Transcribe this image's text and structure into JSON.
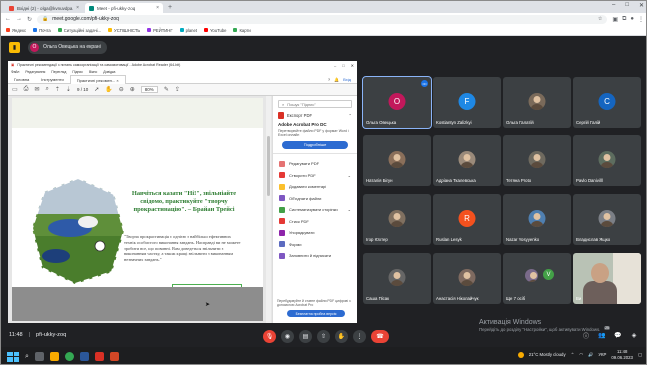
{
  "browser": {
    "tabs": [
      {
        "title": "Вхідні (2) - olga@kvnuvdpa.ua",
        "fav": "#ea4335",
        "active": false
      },
      {
        "title": "Meet - pfi-ukky-zoq",
        "fav": "#00897b",
        "active": true
      }
    ],
    "new_tab": "+",
    "url": "meet.google.com/pfi-ukky-zoq",
    "bookmarks": [
      {
        "label": "Яндекс",
        "color": "#fc3f1d"
      },
      {
        "label": "Почта",
        "color": "#1a73e8"
      },
      {
        "label": "Ситуаційні задачі...",
        "color": "#34a853"
      },
      {
        "label": "УСПІШНІСТЬ",
        "color": "#fbbc04"
      },
      {
        "label": "РЕЙТИНГ",
        "color": "#9334e6"
      },
      {
        "label": "planet",
        "color": "#00acc1"
      },
      {
        "label": "YouTube",
        "color": "#ff0000"
      },
      {
        "label": "Карти",
        "color": "#34a853"
      }
    ]
  },
  "meet": {
    "presenter_initial": "О",
    "presenter_label": "Ольга Овецька на екрані",
    "meeting_time": "11:48",
    "meeting_code": "pfi-ukky-zoq",
    "participant_count": "25"
  },
  "acrobat": {
    "title": "Практичні рекомендації з питань самоорганізації та самомотивації - Adobe Acrobat Reader (64-bit)",
    "menu": [
      "Файл",
      "Редагування",
      "Перегляд",
      "Підпис",
      "Вікно",
      "Довідка"
    ],
    "tabs": [
      "Головна",
      "Інструменти",
      "Практичні рекомен... ×"
    ],
    "sign_in": "Вхід",
    "page_num": "9 / 10",
    "zoom": "80%",
    "quote_heading": "Навчіться казати \"Ні!\", звільніайте свідомо, практикуйте \"творчу прокрастинацію\". – Брайан Трейсі",
    "quote_body": "\"Творча прокрастинація є однією з найбільш ефективних технік особистого виконання завдань. Насправді ви не можете зробити все, що повинні. Вам доведеться звільнити з виконанням частку, а також кращі звільнити з виконанням незначних завдань.\"",
    "quote_author": "–каже Брайан Трейсі",
    "right_pane": {
      "search_placeholder": "Пошук \"Підпис\"",
      "export_label": "Експорт PDF",
      "product": "Adobe Acrobat Pro DC",
      "product_desc": "Перетворюйте файли PDF у формат Word і Excel онлайн",
      "buy_button": "Подробніше",
      "tools": [
        {
          "label": "Редагувати PDF",
          "color": "#e57373"
        },
        {
          "label": "Створити PDF",
          "color": "#e53935"
        },
        {
          "label": "Додавати коментарі",
          "color": "#fbc02d"
        },
        {
          "label": "Об'єднати файли",
          "color": "#7e57c2"
        },
        {
          "label": "Систематизувати сторінки",
          "color": "#43a047"
        },
        {
          "label": "Стиск PDF",
          "color": "#e53935"
        },
        {
          "label": "Упорядкувати",
          "color": "#8e24aa"
        },
        {
          "label": "Форми",
          "color": "#5c6bc0"
        },
        {
          "label": "Заповнити й підписати",
          "color": "#7e57c2"
        }
      ],
      "footer": "Перебудовуйте й ставте файли PDF цифрові з допомогою Acrobat Pro",
      "trial_button": "Безплатна пробна версія"
    }
  },
  "participants": [
    {
      "name": "Ольга Овецька",
      "initial": "О",
      "color": "#c2185b",
      "kind": "letter",
      "speaking": true
    },
    {
      "name": "Kostiantyn Zalizkyi",
      "initial": "F",
      "color": "#1e88e5",
      "kind": "letter"
    },
    {
      "name": "Ольга Галатій",
      "initial": "",
      "color": "#7a6a5a",
      "kind": "photo"
    },
    {
      "name": "Сергій Галій",
      "initial": "С",
      "color": "#1565c0",
      "kind": "letter"
    },
    {
      "name": "Наталія Бігун",
      "initial": "",
      "color": "#8a6f5a",
      "kind": "photo"
    },
    {
      "name": "Адріана Ткалевська",
      "initial": "",
      "color": "#9a8a7a",
      "kind": "photo"
    },
    {
      "name": "Тетяна Proto",
      "initial": "",
      "color": "#6f6a5f",
      "kind": "photo"
    },
    {
      "name": "Pavlo Danivilll",
      "initial": "",
      "color": "#5d6d5f",
      "kind": "photo"
    },
    {
      "name": "Ігор Юхтер",
      "initial": "",
      "color": "#807060",
      "kind": "photo"
    },
    {
      "name": "Ruslan Lesyk",
      "initial": "R",
      "color": "#f4511e",
      "kind": "letter"
    },
    {
      "name": "Nazar Yosyyenko",
      "initial": "",
      "color": "#4f7fb0",
      "kind": "photo"
    },
    {
      "name": "Владислав Ящко",
      "initial": "",
      "color": "#7b7f86",
      "kind": "photo"
    },
    {
      "name": "Саша Пісак",
      "initial": "",
      "color": "#666",
      "kind": "photo"
    },
    {
      "name": "Анастасія Ніколайчук",
      "initial": "",
      "color": "#7e6a60",
      "kind": "photo"
    },
    {
      "name": "Ще 7 осіб",
      "initial": "V",
      "color": "#43a047",
      "kind": "more"
    },
    {
      "name": "Ви",
      "initial": "",
      "color": "#b9c2b5",
      "kind": "video"
    }
  ],
  "watermark": {
    "line1": "Активація Windows",
    "line2": "Перейдіть до розділу \"Настройки\", щоб активувати Windows."
  },
  "taskbar": {
    "weather": "21°C  Mostly cloudy",
    "lang": "УКР",
    "time": "11:48",
    "date": "09.06.2023"
  }
}
